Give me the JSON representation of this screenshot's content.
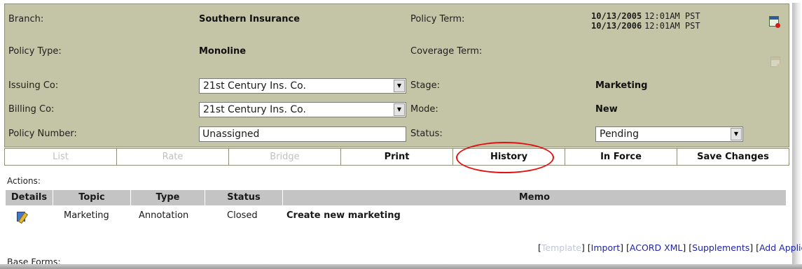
{
  "policy": {
    "branch_label": "Branch:",
    "branch_value": "Southern Insurance",
    "policy_type_label": "Policy Type:",
    "policy_type_value": "Monoline",
    "issuing_co_label": "Issuing Co:",
    "issuing_co_value": "21st Century Ins. Co.",
    "billing_co_label": "Billing Co:",
    "billing_co_value": "21st Century Ins. Co.",
    "policy_number_label": "Policy Number:",
    "policy_number_value": "Unassigned",
    "policy_term_label": "Policy Term:",
    "term_start_date": "10/13/2005",
    "term_start_time": "12:01AM PST",
    "term_end_date": "10/13/2006",
    "term_end_time": "12:01AM PST",
    "coverage_term_label": "Coverage Term:",
    "stage_label": "Stage:",
    "stage_value": "Marketing",
    "mode_label": "Mode:",
    "mode_value": "New",
    "status_label": "Status:",
    "status_value": "Pending"
  },
  "icons": {
    "calendar": "calendar-icon",
    "calendar_disabled": "calendar-disabled-icon",
    "edit": "edit-details-icon",
    "dropdown": "dropdown-arrow-icon"
  },
  "buttons": {
    "list": "List",
    "rate": "Rate",
    "bridge": "Bridge",
    "print": "Print",
    "history": "History",
    "in_force": "In Force",
    "save_changes": "Save Changes"
  },
  "actions": {
    "label": "Actions:",
    "columns": [
      "Details",
      "Topic",
      "Type",
      "Status",
      "Memo"
    ],
    "rows": [
      {
        "topic": "Marketing",
        "type": "Annotation",
        "status": "Closed",
        "memo": "Create new marketing"
      }
    ]
  },
  "links": {
    "template": "Template",
    "import": "Import",
    "acord_xml": "ACORD XML",
    "supplements": "Supplements",
    "add_application": "Add Application"
  },
  "base_forms_label": "Base Forms:",
  "colors": {
    "panel_bg": "#c4c4a6",
    "header_bg": "#c4c4c4",
    "link": "#1f24a8",
    "highlight_ring": "#e11212"
  }
}
